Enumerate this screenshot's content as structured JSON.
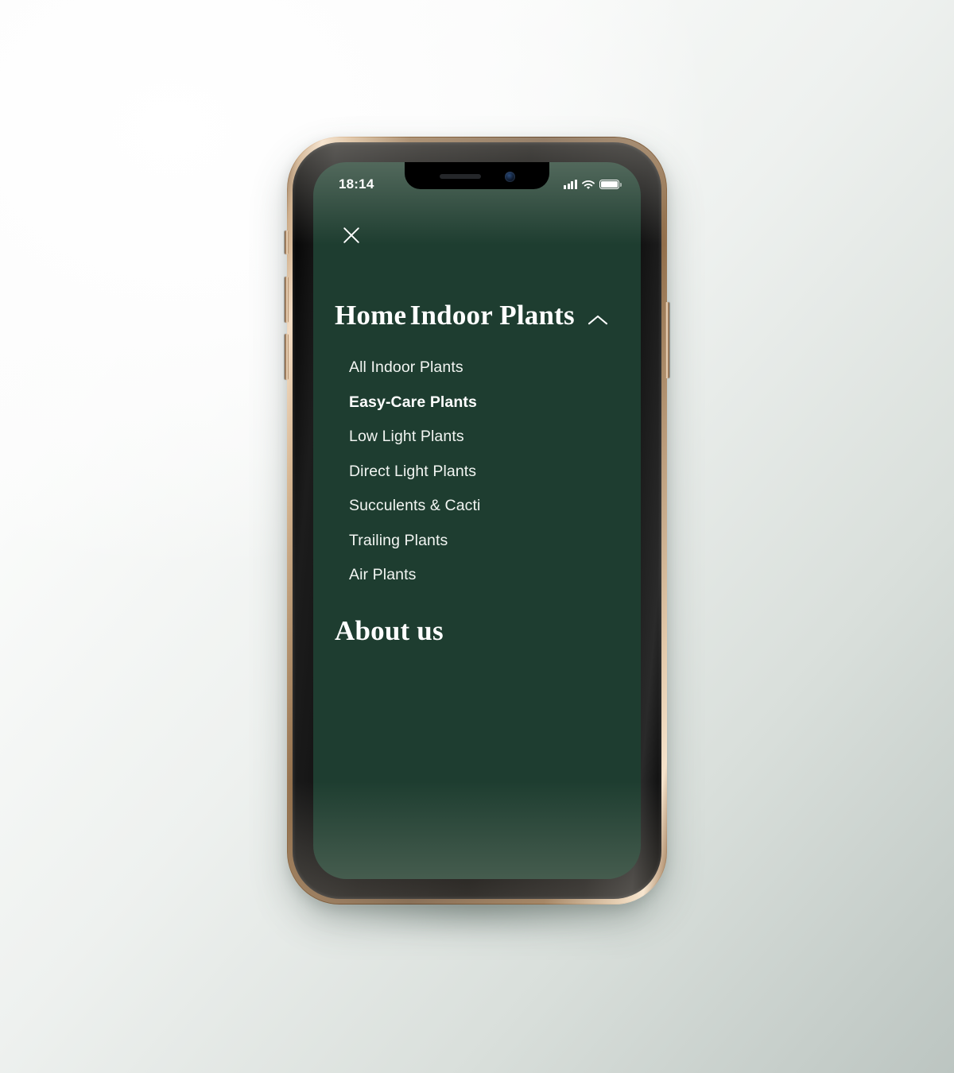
{
  "status_bar": {
    "time": "18:14",
    "signal_icon": "signal-bars-icon",
    "wifi_icon": "wifi-icon",
    "battery_icon": "battery-full-icon"
  },
  "theme": {
    "screen_bg": "#1e3d30",
    "text": "#ffffff",
    "frame_gold": "#d8b894"
  },
  "menu": {
    "close_label": "close-menu",
    "items": [
      {
        "label": "Home",
        "type": "main",
        "expandable": false
      },
      {
        "label": "Indoor Plants",
        "type": "main",
        "expandable": true,
        "expanded": true,
        "chevron": "chevron-up-icon",
        "children": [
          {
            "label": "All Indoor Plants",
            "active": false
          },
          {
            "label": "Easy-Care Plants",
            "active": true
          },
          {
            "label": "Low Light Plants",
            "active": false
          },
          {
            "label": "Direct Light Plants",
            "active": false
          },
          {
            "label": "Succulents & Cacti",
            "active": false
          },
          {
            "label": "Trailing Plants",
            "active": false
          },
          {
            "label": "Air Plants",
            "active": false
          }
        ]
      },
      {
        "label": "About us",
        "type": "main",
        "expandable": false
      }
    ]
  }
}
